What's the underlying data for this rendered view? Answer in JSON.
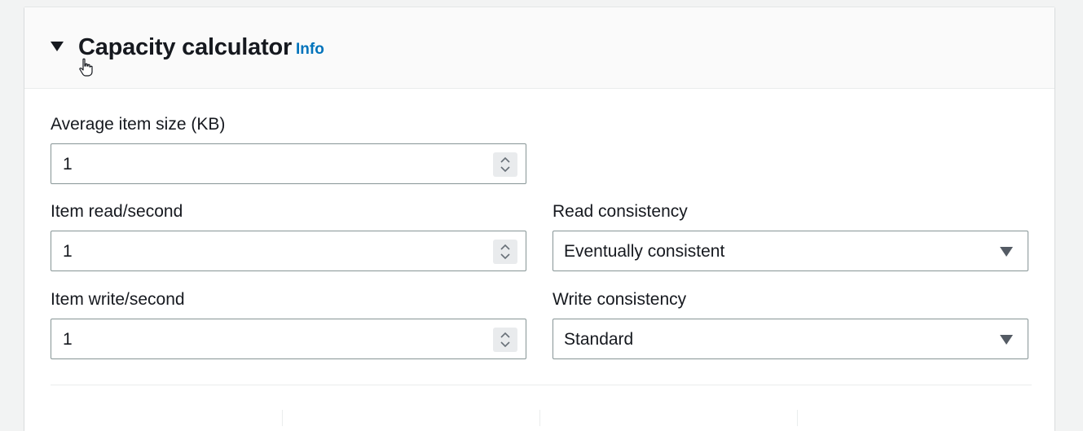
{
  "section": {
    "title": "Capacity calculator",
    "info_label": "Info"
  },
  "fields": {
    "avg_item_size": {
      "label": "Average item size (KB)",
      "value": "1"
    },
    "item_read": {
      "label": "Item read/second",
      "value": "1"
    },
    "item_write": {
      "label": "Item write/second",
      "value": "1"
    },
    "read_consistency": {
      "label": "Read consistency",
      "value": "Eventually consistent"
    },
    "write_consistency": {
      "label": "Write consistency",
      "value": "Standard"
    }
  },
  "icons": {
    "expand": "caret-down-icon",
    "spinner": "up-down-chevron-icon",
    "dropdown": "triangle-down-icon",
    "cursor": "hand-pointer-icon"
  },
  "colors": {
    "link": "#0073bb",
    "text": "#16191f",
    "border": "#879596",
    "header_bg": "#fafafa",
    "page_bg": "#f2f3f3"
  }
}
